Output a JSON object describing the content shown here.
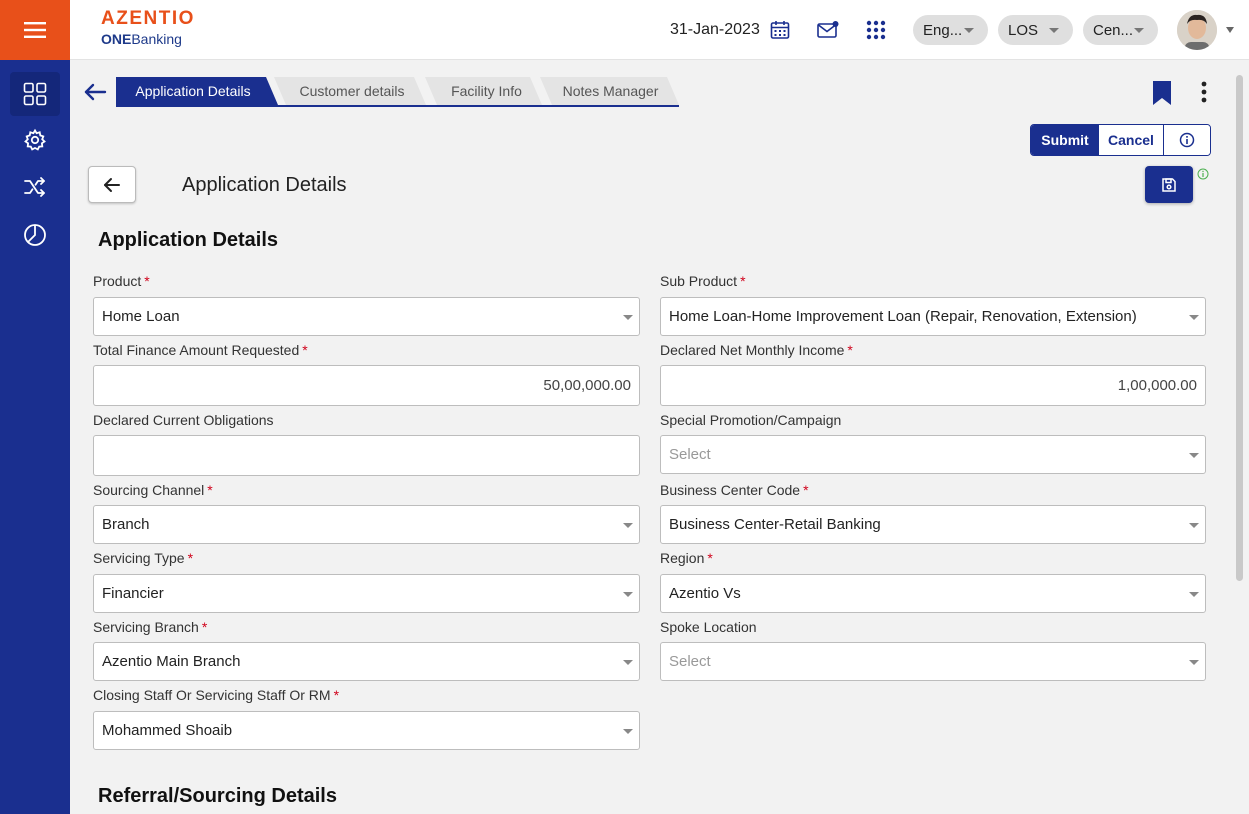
{
  "header": {
    "brand": "AZENTIO",
    "sub_brand_prefix": "ONE",
    "sub_brand_suffix": "Banking",
    "date": "31-Jan-2023",
    "language": "Eng...",
    "module": "LOS",
    "center": "Cen..."
  },
  "tabs": [
    {
      "label": "Application Details"
    },
    {
      "label": "Customer details"
    },
    {
      "label": "Facility Info"
    },
    {
      "label": "Notes Manager"
    }
  ],
  "actions": {
    "submit": "Submit",
    "cancel": "Cancel"
  },
  "page": {
    "title": "Application Details"
  },
  "sections": {
    "application_details": "Application Details",
    "referral": "Referral/Sourcing Details"
  },
  "fields": {
    "product": {
      "label": "Product",
      "value": "Home Loan"
    },
    "sub_product": {
      "label": "Sub Product",
      "value": "Home Loan-Home Improvement Loan (Repair, Renovation, Extension)"
    },
    "finance_amount": {
      "label": "Total Finance Amount Requested",
      "value": "50,00,000.00"
    },
    "net_income": {
      "label": "Declared Net Monthly Income",
      "value": "1,00,000.00"
    },
    "obligations": {
      "label": "Declared Current Obligations",
      "value": ""
    },
    "promotion": {
      "label": "Special Promotion/Campaign",
      "placeholder": "Select"
    },
    "sourcing_channel": {
      "label": "Sourcing Channel",
      "value": "Branch"
    },
    "business_center": {
      "label": "Business Center Code",
      "value": "Business Center-Retail Banking"
    },
    "servicing_type": {
      "label": "Servicing Type",
      "value": "Financier"
    },
    "region": {
      "label": "Region",
      "value": "Azentio Vs"
    },
    "servicing_branch": {
      "label": "Servicing Branch",
      "value": "Azentio Main Branch"
    },
    "spoke_location": {
      "label": "Spoke Location",
      "placeholder": "Select"
    },
    "closing_staff": {
      "label": "Closing Staff Or Servicing Staff Or RM",
      "value": "Mohammed Shoaib"
    }
  },
  "required_mark": "*",
  "colors": {
    "brand_orange": "#e8501a",
    "sidebar_blue": "#1a2f8f",
    "required_red": "#d0021b"
  }
}
